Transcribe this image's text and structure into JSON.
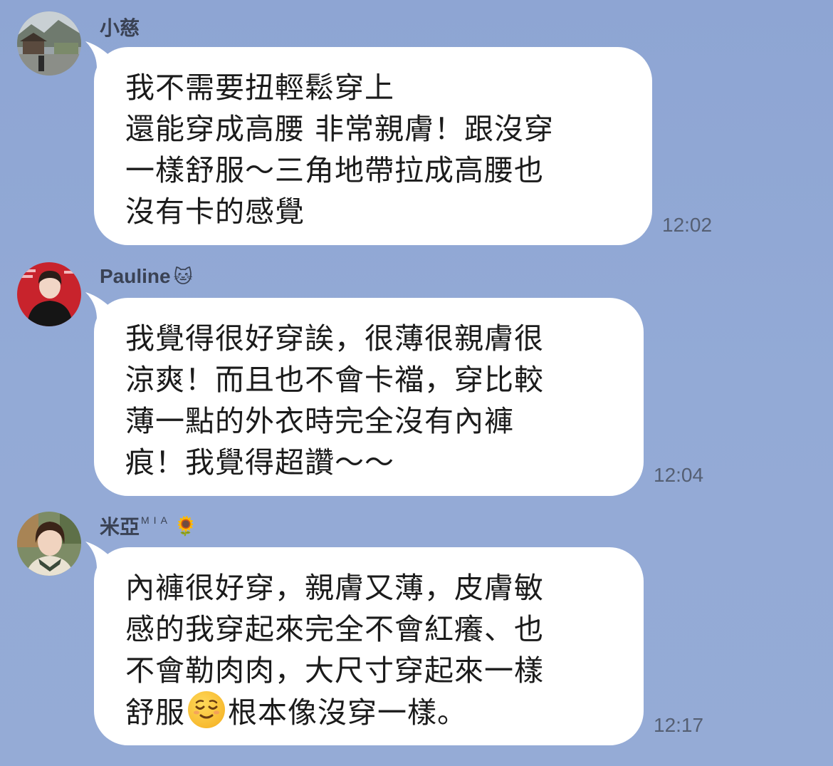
{
  "messages": [
    {
      "sender": "小慈",
      "sender_suffix": "",
      "sender_emoji": "",
      "text": "我不需要扭輕鬆穿上\n還能穿成高腰 非常親膚！跟沒穿\n一樣舒服～三角地帶拉成高腰也\n沒有卡的感覺",
      "time": "12:02"
    },
    {
      "sender": "Pauline",
      "sender_suffix": "",
      "sender_emoji": "🐱",
      "text": "我覺得很好穿誒，很薄很親膚很\n涼爽！而且也不會卡襠，穿比較\n薄一點的外衣時完全沒有內褲\n痕！我覺得超讚～～",
      "time": "12:04"
    },
    {
      "sender": "米亞",
      "sender_suffix": "MIA",
      "sender_emoji": "🌻",
      "text_before_emoji": "內褲很好穿，親膚又薄，皮膚敏\n感的我穿起來完全不會紅癢、也\n不會勒肉肉，大尺寸穿起來一樣\n舒服",
      "inline_emoji": "relieved-face-emoji",
      "text_after_emoji": "根本像沒穿一樣。",
      "time": "12:17"
    }
  ],
  "colors": {
    "background": "#91a7d4",
    "bubble": "#ffffff",
    "sender": "#3a4254",
    "time": "#555f73"
  }
}
